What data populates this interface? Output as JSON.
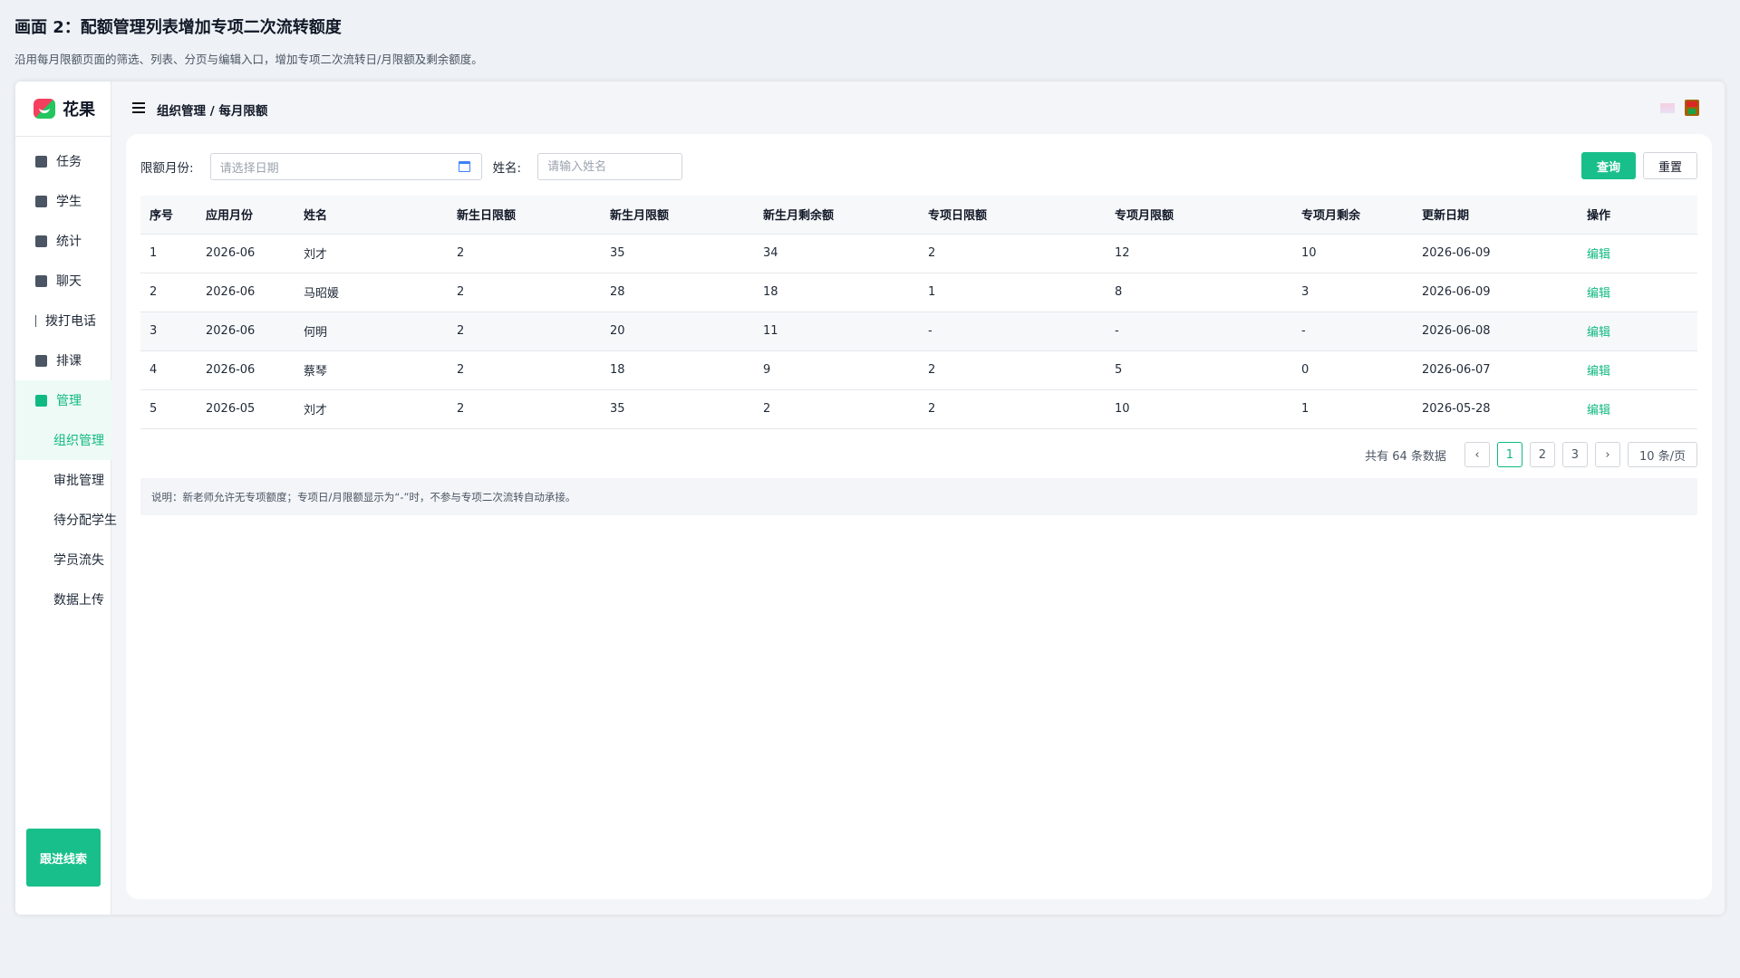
{
  "page": {
    "title": "画面 2：配额管理列表增加专项二次流转额度",
    "subtitle": "沿用每月限额页面的筛选、列表、分页与编辑入口，增加专项二次流转日/月限额及剩余额度。"
  },
  "brand": {
    "name": "花果",
    "accent": "#19bf8a"
  },
  "sidebar": {
    "items": [
      {
        "label": "任务",
        "icon": "square-icon"
      },
      {
        "label": "学生",
        "icon": "square-icon"
      },
      {
        "label": "统计",
        "icon": "square-icon"
      },
      {
        "label": "聊天",
        "icon": "square-icon"
      },
      {
        "label": "拨打电话",
        "icon": "bar-icon"
      },
      {
        "label": "排课",
        "icon": "square-icon"
      },
      {
        "label": "管理",
        "icon": "square-icon",
        "active": true
      }
    ],
    "subitems": [
      {
        "label": "组织管理",
        "active": true
      },
      {
        "label": "审批管理"
      },
      {
        "label": "待分配学生"
      },
      {
        "label": "学员流失"
      },
      {
        "label": "数据上传"
      }
    ],
    "followup_label": "跟进线索"
  },
  "header": {
    "breadcrumb": "组织管理 / 每月限额"
  },
  "filters": {
    "month_label": "限额月份:",
    "month_placeholder": "请选择日期",
    "name_label": "姓名:",
    "name_placeholder": "请输入姓名",
    "query_label": "查询",
    "reset_label": "重置"
  },
  "table": {
    "columns": [
      "序号",
      "应用月份",
      "姓名",
      "新生日限额",
      "新生月限额",
      "新生月剩余额",
      "专项日限额",
      "专项月限额",
      "专项月剩余",
      "更新日期",
      "操作"
    ],
    "rows": [
      [
        "1",
        "2026-06",
        "刘才",
        "2",
        "35",
        "34",
        "2",
        "12",
        "10",
        "2026-06-09",
        "编辑"
      ],
      [
        "2",
        "2026-06",
        "马昭媛",
        "2",
        "28",
        "18",
        "1",
        "8",
        "3",
        "2026-06-09",
        "编辑"
      ],
      [
        "3",
        "2026-06",
        "何明",
        "2",
        "20",
        "11",
        "-",
        "-",
        "-",
        "2026-06-08",
        "编辑"
      ],
      [
        "4",
        "2026-06",
        "蔡琴",
        "2",
        "18",
        "9",
        "2",
        "5",
        "0",
        "2026-06-07",
        "编辑"
      ],
      [
        "5",
        "2026-05",
        "刘才",
        "2",
        "35",
        "2",
        "2",
        "10",
        "1",
        "2026-05-28",
        "编辑"
      ]
    ]
  },
  "pagination": {
    "total_text": "共有 64 条数据",
    "prev": "‹",
    "pages": [
      "1",
      "2",
      "3"
    ],
    "current": "1",
    "next": "›",
    "page_size": "10 条/页"
  },
  "note": "说明：新老师允许无专项额度；专项日/月限额显示为“-”时，不参与专项二次流转自动承接。"
}
